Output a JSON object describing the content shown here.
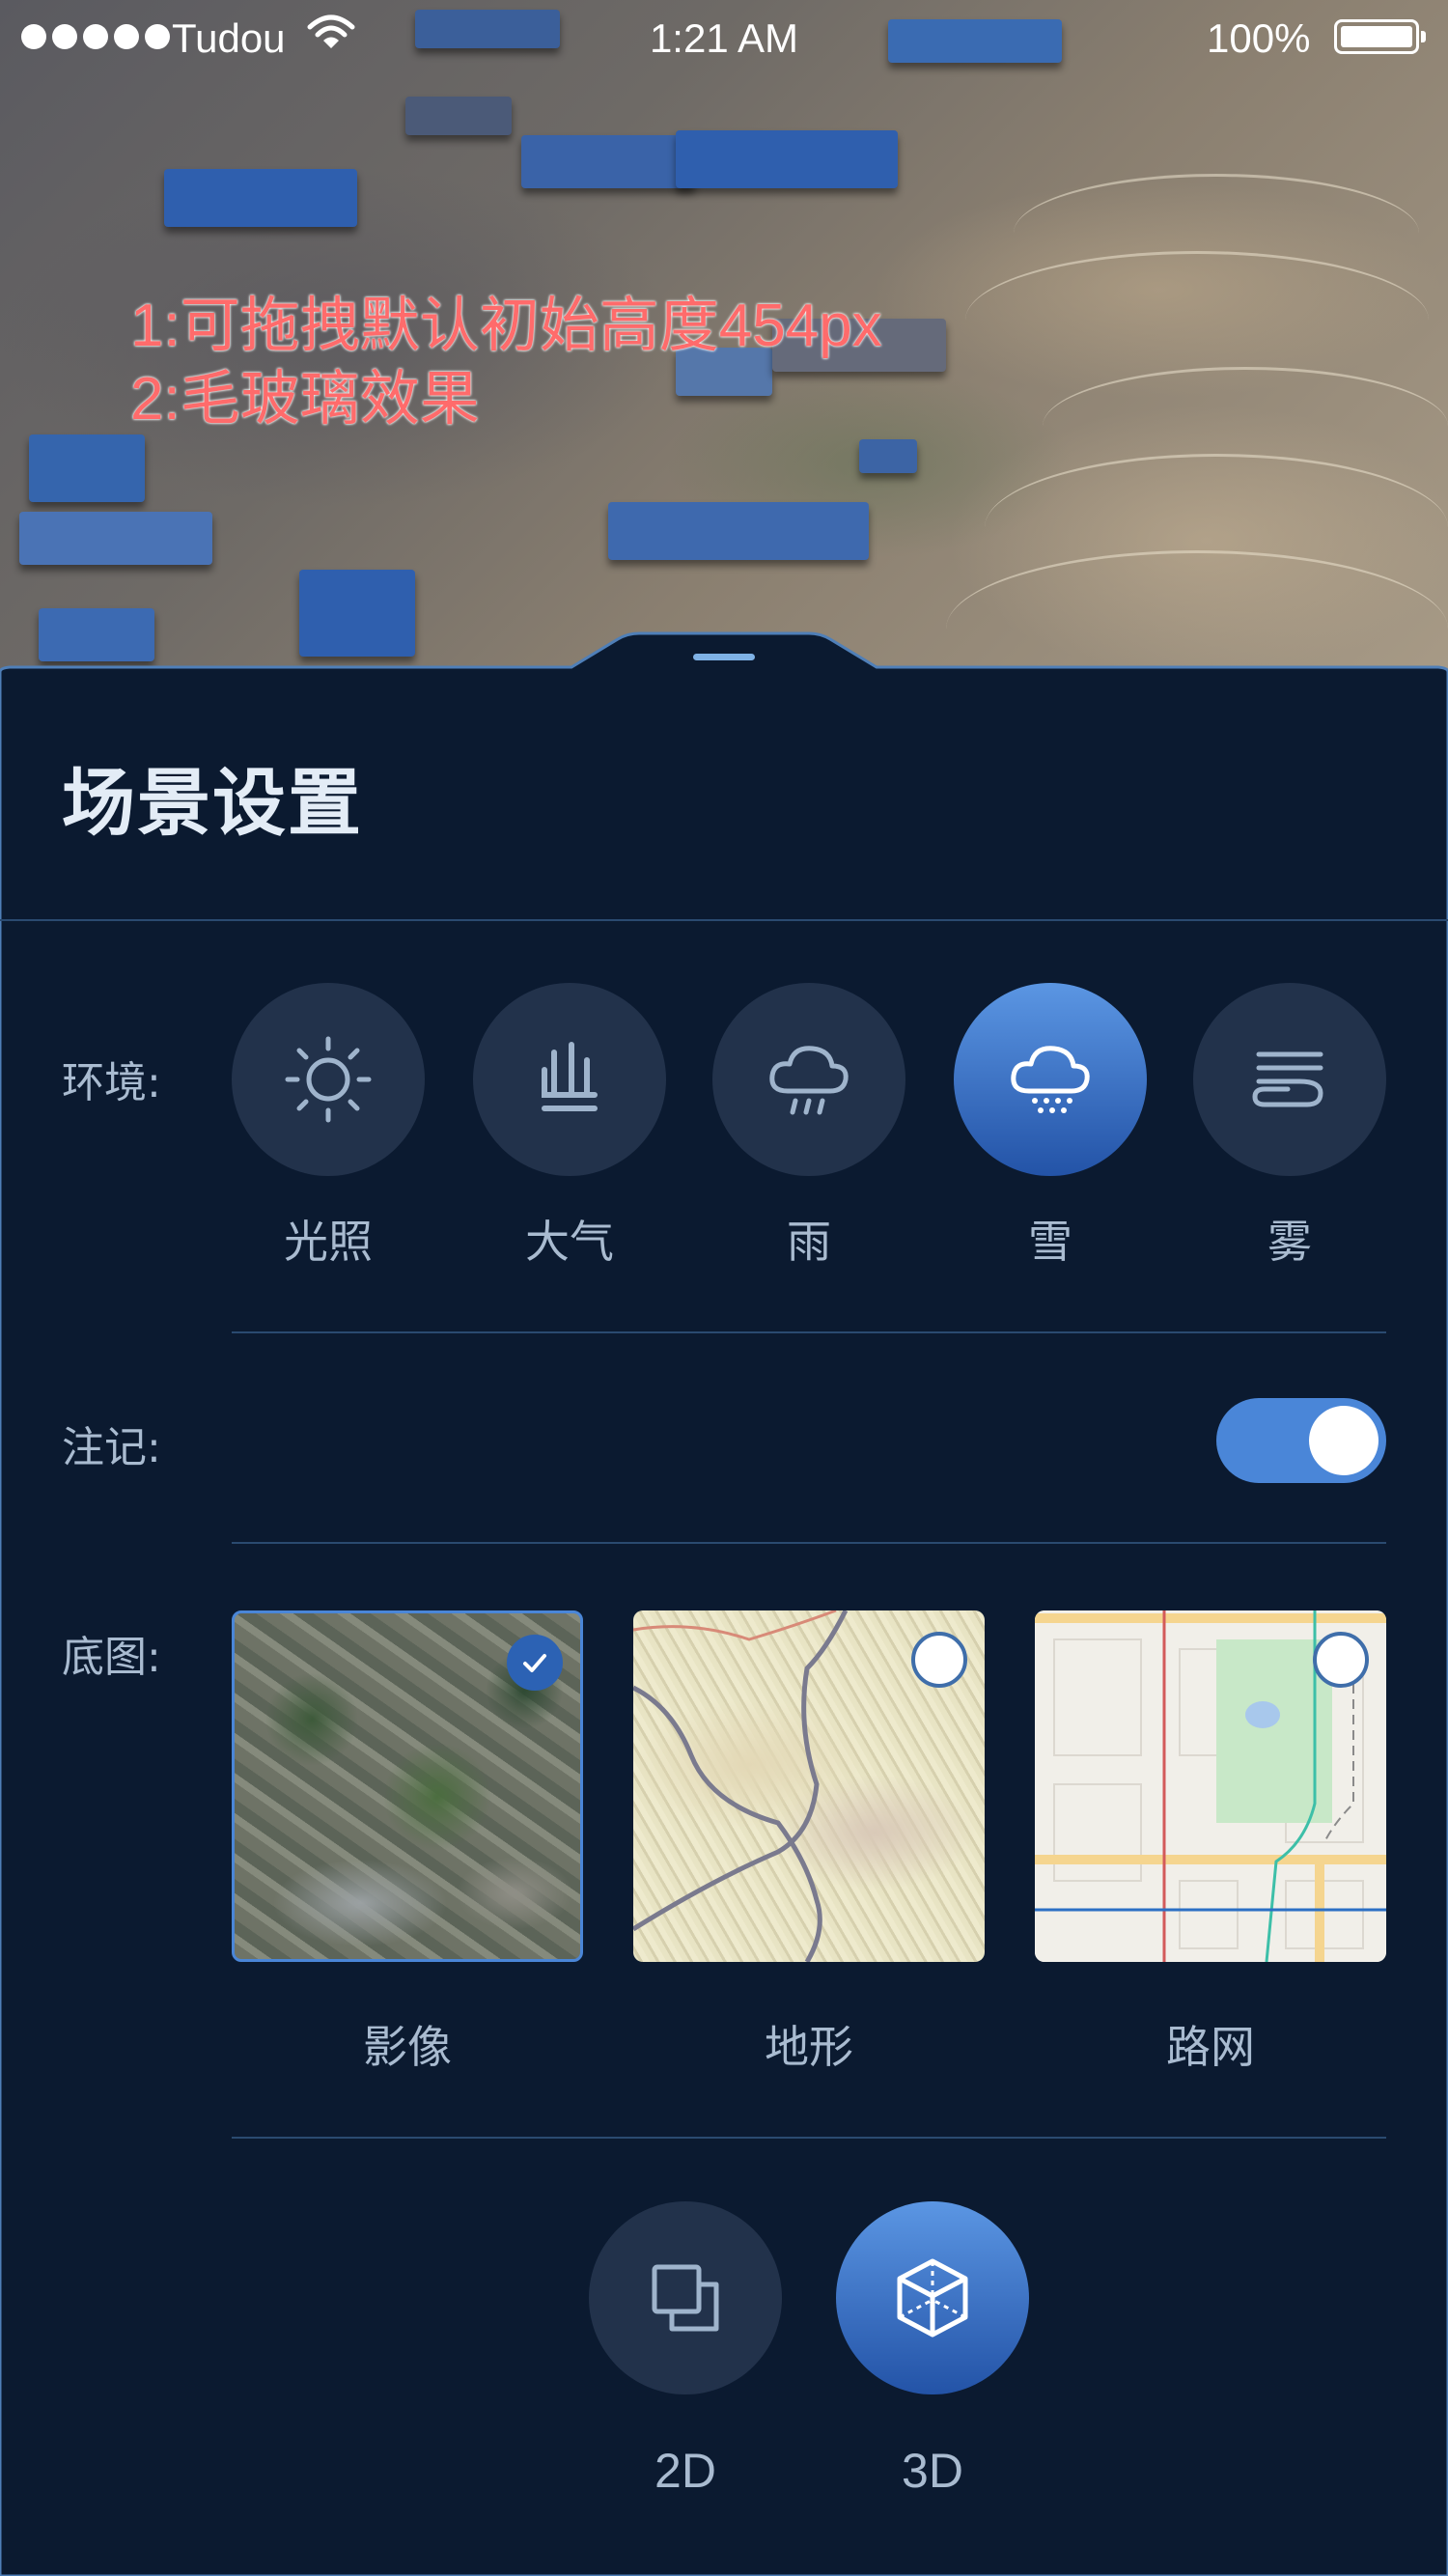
{
  "status_bar": {
    "carrier": "Tudou",
    "time": "1:21 AM",
    "battery": "100%"
  },
  "annotation": {
    "line1": "1:可拖拽默认初始高度454px",
    "line2": "2:毛玻璃效果"
  },
  "panel": {
    "title": "场景设置",
    "environment": {
      "label": "环境:",
      "items": [
        {
          "label": "光照",
          "icon": "sun-icon"
        },
        {
          "label": "大气",
          "icon": "atmosphere-icon"
        },
        {
          "label": "雨",
          "icon": "rain-icon"
        },
        {
          "label": "雪",
          "icon": "snow-icon",
          "active": true
        },
        {
          "label": "雾",
          "icon": "fog-icon"
        }
      ]
    },
    "annotation_toggle": {
      "label": "注记:",
      "on": true
    },
    "basemap": {
      "label": "底图:",
      "items": [
        {
          "label": "影像",
          "selected": true
        },
        {
          "label": "地形",
          "selected": false
        },
        {
          "label": "路网",
          "selected": false
        }
      ]
    },
    "view_mode": {
      "items": [
        {
          "label": "2D",
          "icon": "2d-icon"
        },
        {
          "label": "3D",
          "icon": "3d-cube-icon",
          "active": true
        }
      ]
    }
  },
  "colors": {
    "panel_bg": "#0b1a30",
    "accent": "#4a86d8",
    "annotation": "#ff6b6b"
  }
}
